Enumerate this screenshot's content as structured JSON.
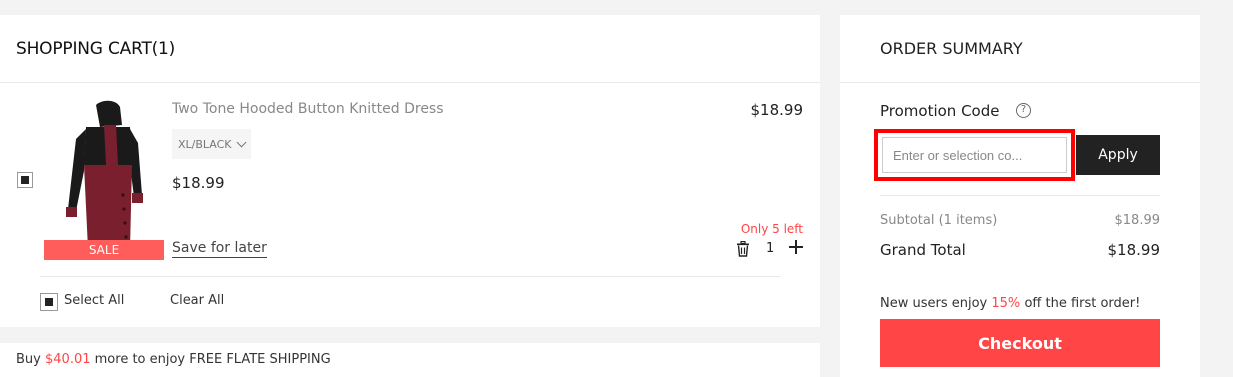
{
  "cart": {
    "title": "SHOPPING CART(1)",
    "item": {
      "name": "Two Tone Hooded Button Knitted Dress",
      "variant": "XL/BLACK",
      "price": "$18.99",
      "line_price": "$18.99",
      "sale_tag": "SALE",
      "save_for_later": "Save for later",
      "stock_note": "Only 5 left",
      "quantity": "1",
      "checked": true
    },
    "select_all_label": "Select All",
    "select_all_checked": true,
    "clear_all_label": "Clear All"
  },
  "shipping": {
    "prefix": "Buy",
    "amount": "$40.01",
    "suffix": "more to enjoy FREE FLATE SHIPPING"
  },
  "summary": {
    "title": "ORDER SUMMARY",
    "promo_label": "Promotion Code",
    "help_symbol": "?",
    "promo_placeholder": "Enter or selection co...",
    "promo_value": "",
    "apply_label": "Apply",
    "subtotal_label": "Subtotal (1 items)",
    "subtotal_value": "$18.99",
    "grand_total_label": "Grand Total",
    "grand_total_value": "$18.99",
    "new_user_prefix": "New users enjoy",
    "new_user_discount": "15%",
    "new_user_suffix": "off the first order!",
    "checkout_label": "Checkout"
  },
  "colors": {
    "accent_red": "#ff4545",
    "sale_tag": "#ff5c5c",
    "highlight_box": "#ff0000",
    "apply_button": "#222222",
    "dress_black": "#1a1a1a",
    "dress_burgundy": "#7a1f2e"
  },
  "icons": {
    "trash": "trash-icon",
    "plus": "plus-icon",
    "help": "help-icon",
    "chevron": "chevron-down-icon"
  }
}
